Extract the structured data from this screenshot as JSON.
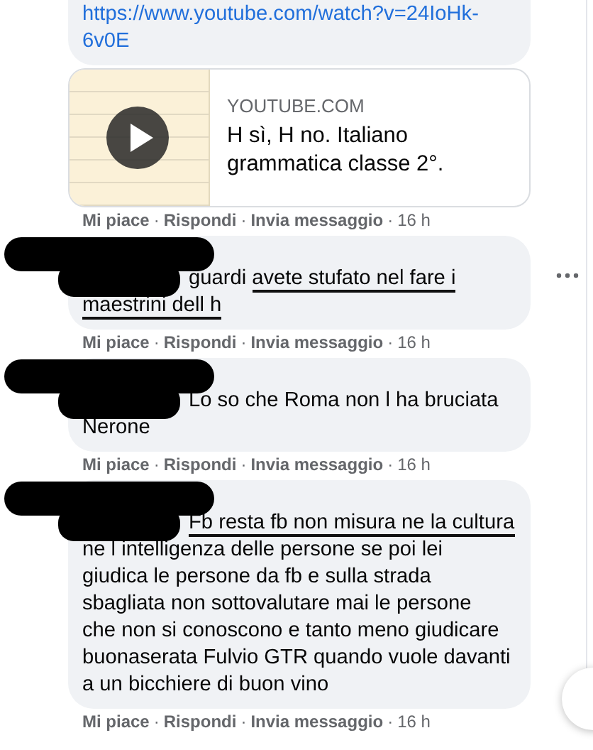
{
  "comments": [
    {
      "kind": "link",
      "url": "https://www.youtube.com/watch?v=24IoHk-\n6v0E",
      "preview": {
        "site": "YOUTUBE.COM",
        "title": "H sì, H no. Italiano\ngrammatica classe 2°."
      },
      "has_menu": false,
      "actions": [
        {
          "kind": "link",
          "label": "Mi piace"
        },
        {
          "kind": "dot",
          "label": "·"
        },
        {
          "kind": "link",
          "label": "Rispondi"
        },
        {
          "kind": "dot",
          "label": "·"
        },
        {
          "kind": "link",
          "label": "Invia messaggio"
        },
        {
          "kind": "dot",
          "label": "·"
        },
        {
          "kind": "time",
          "label": "16 h"
        }
      ]
    },
    {
      "kind": "text",
      "segments": [
        {
          "text": "guardi ",
          "underlined": false
        },
        {
          "text": "avete stufato nel fare i\nmaestrini dell h",
          "underlined": true
        }
      ],
      "has_menu": true,
      "actions": [
        {
          "kind": "link",
          "label": "Mi piace"
        },
        {
          "kind": "dot",
          "label": "·"
        },
        {
          "kind": "link",
          "label": "Rispondi"
        },
        {
          "kind": "dot",
          "label": "·"
        },
        {
          "kind": "link",
          "label": "Invia messaggio"
        },
        {
          "kind": "dot",
          "label": "·"
        },
        {
          "kind": "time",
          "label": "16 h"
        }
      ]
    },
    {
      "kind": "text",
      "segments": [
        {
          "text": "Lo so che Roma non l ha bruciata\nNerone",
          "underlined": false
        }
      ],
      "has_menu": false,
      "actions": [
        {
          "kind": "link",
          "label": "Mi piace"
        },
        {
          "kind": "dot",
          "label": "·"
        },
        {
          "kind": "link",
          "label": "Rispondi"
        },
        {
          "kind": "dot",
          "label": "·"
        },
        {
          "kind": "link",
          "label": "Invia messaggio"
        },
        {
          "kind": "dot",
          "label": "·"
        },
        {
          "kind": "time",
          "label": "16 h"
        }
      ]
    },
    {
      "kind": "text",
      "segments": [
        {
          "text": "Fb resta fb non misura ne la cultura",
          "underlined": true
        },
        {
          "text": "\nne l intelligenza delle persone se poi lei\ngiudica le persone da fb e sulla strada\nsbagliata non sottovalutare mai le persone\nche non si conoscono e tanto meno giudicare\nbuonaserata Fulvio GTR quando vuole davanti\na un bicchiere di buon vino",
          "underlined": false
        }
      ],
      "has_menu": false,
      "actions": [
        {
          "kind": "link",
          "label": "Mi piace"
        },
        {
          "kind": "dot",
          "label": "·"
        },
        {
          "kind": "link",
          "label": "Rispondi"
        },
        {
          "kind": "dot",
          "label": "·"
        },
        {
          "kind": "link",
          "label": "Invia messaggio"
        },
        {
          "kind": "dot",
          "label": "·"
        },
        {
          "kind": "time",
          "label": "16 h"
        }
      ]
    }
  ]
}
